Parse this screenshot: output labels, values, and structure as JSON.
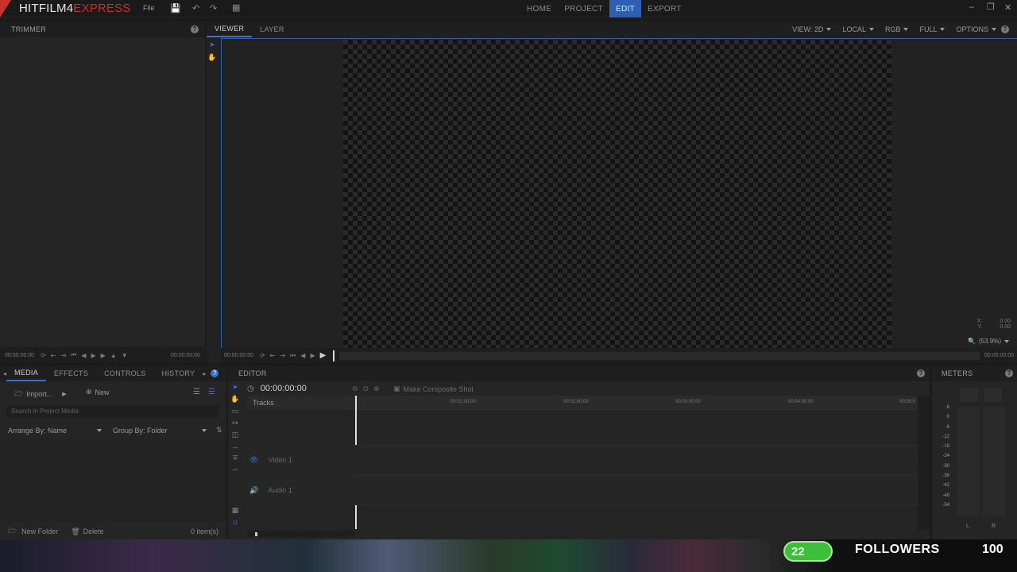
{
  "app": {
    "logo_main": "HITFILM",
    "logo_num": "4",
    "logo_sub": "EXPRESS",
    "menu_file": "File"
  },
  "nav": {
    "tabs": [
      "HOME",
      "PROJECT",
      "EDIT",
      "EXPORT"
    ],
    "active": "EDIT"
  },
  "trimmer": {
    "title": "TRIMMER",
    "time_left": "00:00:00:00",
    "time_right": "00:00:00:00"
  },
  "viewer": {
    "tabs": [
      "VIEWER",
      "LAYER"
    ],
    "view_mode": "VIEW: 2D",
    "space": "LOCAL",
    "channel": "RGB",
    "quality": "FULL",
    "options": "OPTIONS",
    "x_label": "X:",
    "x_value": "0.00",
    "y_label": "Y:",
    "y_value": "0.00",
    "zoom": "(53.9%)",
    "time_left": "00:00:00:00",
    "time_right": "00:05:00:00"
  },
  "media": {
    "tabs": [
      "MEDIA",
      "EFFECTS",
      "CONTROLS",
      "HISTORY"
    ],
    "import_label": "Import...",
    "new_label": "New",
    "search_placeholder": "Search in Project Media",
    "arrange_by": "Arrange By: Name",
    "group_by": "Group By: Folder",
    "new_folder": "New Folder",
    "delete": "Delete",
    "item_count": "0 item(s)"
  },
  "editor": {
    "title": "EDITOR",
    "timecode": "00:00:00:00",
    "composite": "Make Composite Shot",
    "tracks_label": "Tracks",
    "ruler": [
      "00:01:00:00",
      "00:02:00:00",
      "00:03:00:00",
      "00:04:00:00",
      "00:05:0"
    ],
    "video_track": "Video 1",
    "audio_track": "Audio 1"
  },
  "meters": {
    "title": "METERS",
    "scale": [
      "6",
      "0",
      "-6",
      "-12",
      "-18",
      "-24",
      "-30",
      "-36",
      "-42",
      "-48",
      "-54"
    ],
    "left": "L",
    "right": "R"
  },
  "stream_overlay": {
    "count": "22",
    "label": "FOLLOWERS",
    "goal": "100"
  },
  "colors": {
    "accent": "#2f5fb3",
    "logo_red": "#c8322a",
    "followers_green": "#3dbf3a"
  }
}
